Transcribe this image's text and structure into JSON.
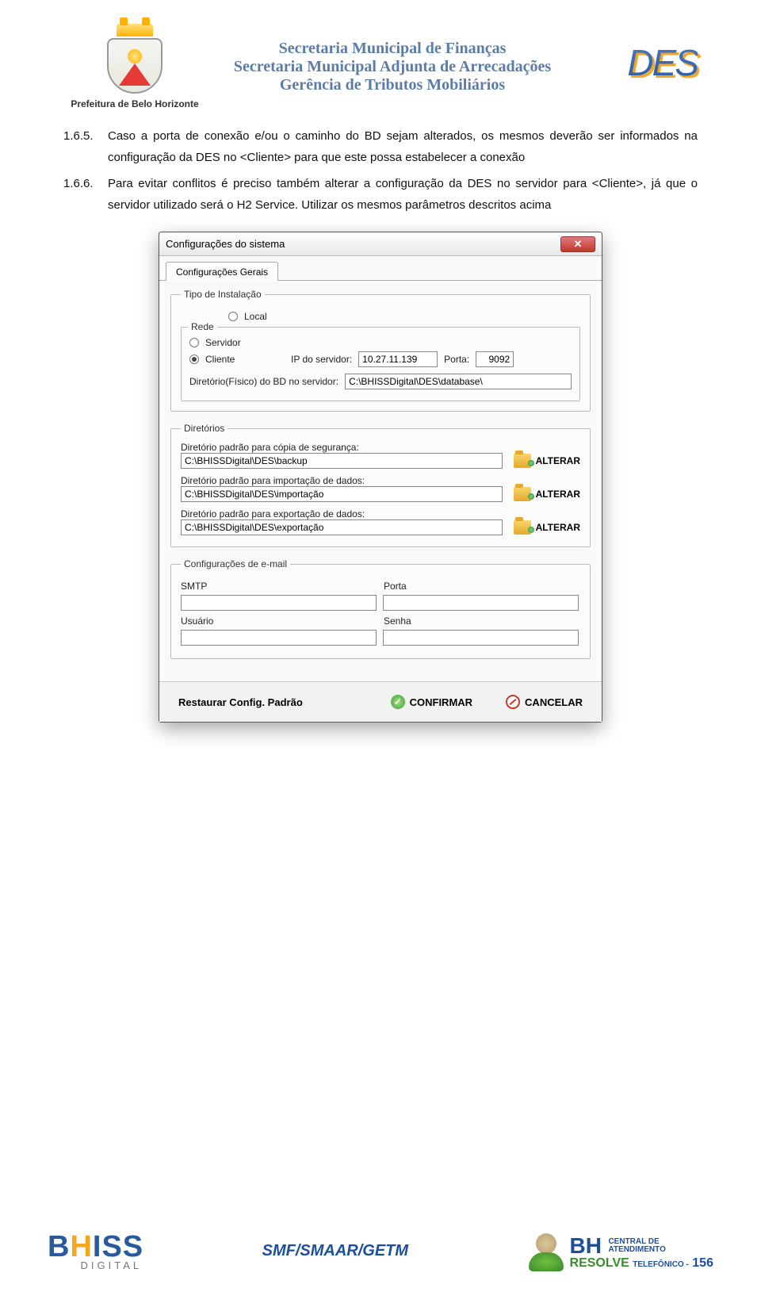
{
  "header": {
    "prefeitura": "Prefeitura de Belo Horizonte",
    "line1": "Secretaria Municipal de Finanças",
    "line2": "Secretaria Municipal Adjunta de Arrecadações",
    "line3": "Gerência de Tributos Mobiliários",
    "des": "DES"
  },
  "items": [
    {
      "num": "1.6.5.",
      "text": "Caso a porta de conexão e/ou o caminho do BD sejam alterados, os mesmos deverão ser informados na configuração da DES no <Cliente> para que este possa estabelecer a conexão"
    },
    {
      "num": "1.6.6.",
      "text": "Para evitar conflitos é preciso também alterar a configuração da DES no servidor para <Cliente>, já que o servidor utilizado será o H2 Service. Utilizar os mesmos parâmetros descritos acima"
    }
  ],
  "dialog": {
    "title": "Configurações do sistema",
    "close": "✕",
    "tab": "Configurações Gerais",
    "tipo_instalacao": {
      "legend": "Tipo de Instalação",
      "local": "Local",
      "rede": "Rede",
      "servidor": "Servidor",
      "cliente": "Cliente",
      "ip_label": "IP do servidor:",
      "ip_value": "10.27.11.139",
      "porta_label": "Porta:",
      "porta_value": "9092",
      "dirbd_label": "Diretório(Físico) do BD no servidor:",
      "dirbd_value": "C:\\BHISSDigital\\DES\\database\\"
    },
    "diretorios": {
      "legend": "Diretórios",
      "backup_label": "Diretório padrão para cópia de segurança:",
      "backup_value": "C:\\BHISSDigital\\DES\\backup",
      "import_label": "Diretório padrão para importação de dados:",
      "import_value": "C:\\BHISSDigital\\DES\\importação",
      "export_label": "Diretório padrão para exportação de dados:",
      "export_value": "C:\\BHISSDigital\\DES\\exportação",
      "alterar": "ALTERAR"
    },
    "email": {
      "legend": "Configurações de e-mail",
      "smtp": "SMTP",
      "porta": "Porta",
      "usuario": "Usuário",
      "senha": "Senha"
    },
    "footer": {
      "restaurar": "Restaurar Config. Padrão",
      "confirmar": "CONFIRMAR",
      "cancelar": "CANCELAR"
    }
  },
  "footer": {
    "bhiss": "BHISS",
    "bhiss_sub": "DIGITAL",
    "center": "SMF/SMAAR/GETM",
    "bh": "BH",
    "central": "CENTRAL DE",
    "atendimento": "ATENDIMENTO",
    "resolve": "RESOLVE",
    "telefonico": "TELEFÔNICO -",
    "fone": "156"
  }
}
